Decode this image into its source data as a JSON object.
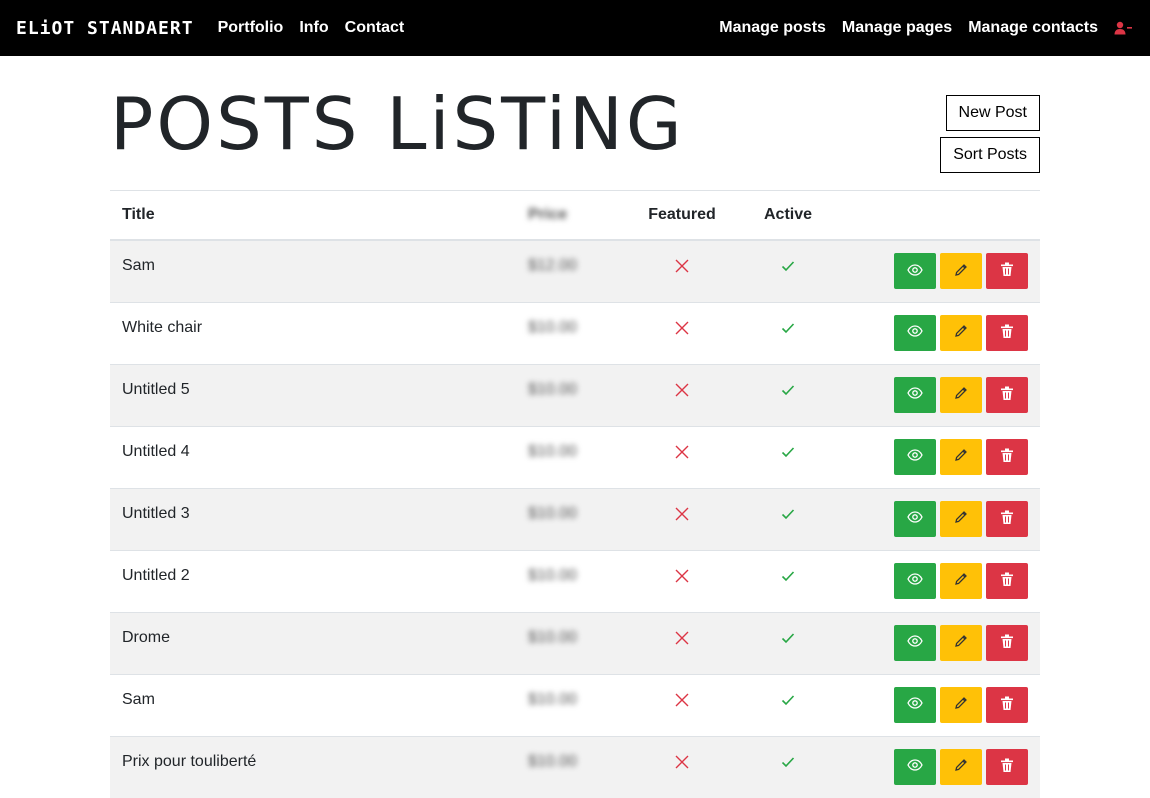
{
  "nav": {
    "brand": "ELiOT STANDAERT",
    "left_links": [
      "Portfolio",
      "Info",
      "Contact"
    ],
    "right_links": [
      "Manage posts",
      "Manage pages",
      "Manage contacts"
    ],
    "user_icon": "user-minus-icon"
  },
  "page": {
    "title": "POSTS LiSTiNG",
    "new_post_label": "New Post",
    "sort_posts_label": "Sort Posts"
  },
  "table": {
    "headers": {
      "title": "Title",
      "price": "Price",
      "featured": "Featured",
      "active": "Active"
    },
    "rows": [
      {
        "title": "Sam",
        "price": "$12.00",
        "featured": false,
        "active": true
      },
      {
        "title": "White chair",
        "price": "$10.00",
        "featured": false,
        "active": true
      },
      {
        "title": "Untitled 5",
        "price": "$10.00",
        "featured": false,
        "active": true
      },
      {
        "title": "Untitled 4",
        "price": "$10.00",
        "featured": false,
        "active": true
      },
      {
        "title": "Untitled 3",
        "price": "$10.00",
        "featured": false,
        "active": true
      },
      {
        "title": "Untitled 2",
        "price": "$10.00",
        "featured": false,
        "active": true
      },
      {
        "title": "Drome",
        "price": "$10.00",
        "featured": false,
        "active": true
      },
      {
        "title": "Sam",
        "price": "$10.00",
        "featured": false,
        "active": true
      },
      {
        "title": "Prix pour touliberté",
        "price": "$10.00",
        "featured": false,
        "active": true
      }
    ]
  },
  "colors": {
    "view_button": "#28a745",
    "edit_button": "#ffc107",
    "delete_button": "#dc3545",
    "cross": "#dc3545",
    "check": "#28a745"
  }
}
